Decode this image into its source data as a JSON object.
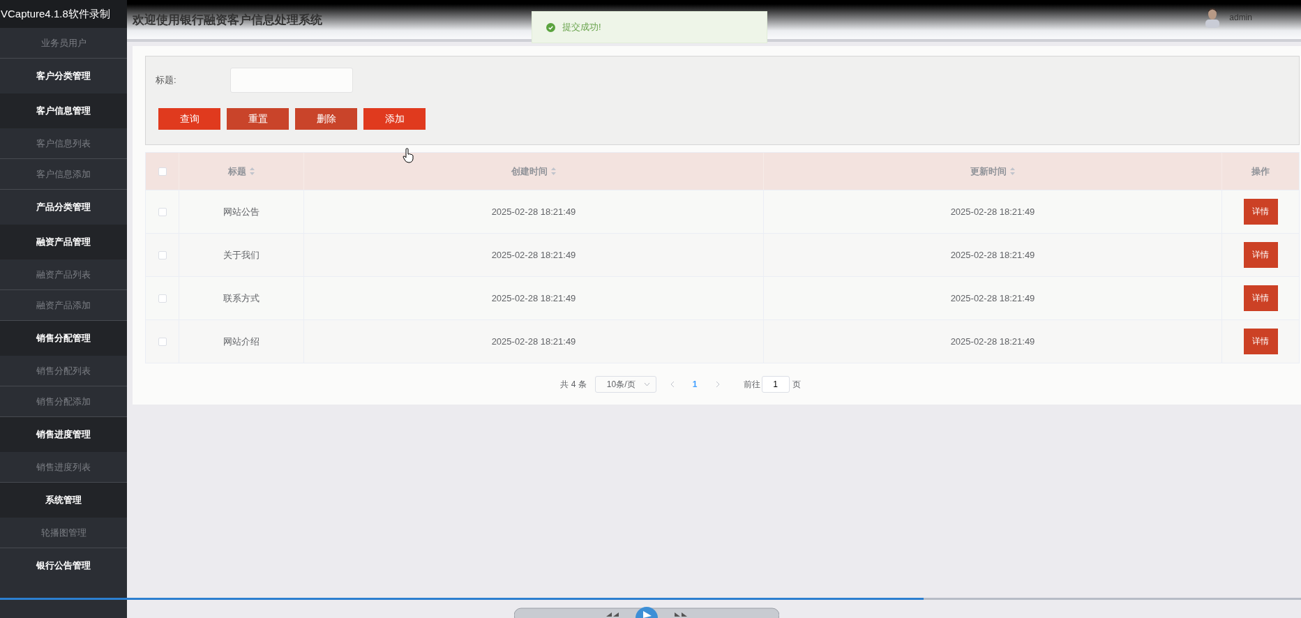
{
  "recorder_overlay": {
    "title": "VCapture4.1.8软件录制"
  },
  "sidebar": {
    "items": [
      {
        "label": "业务员用户",
        "kind": "link"
      },
      {
        "label": "客户分类管理",
        "kind": "group"
      },
      {
        "label": "客户信息管理",
        "kind": "group",
        "children": [
          {
            "label": "客户信息列表",
            "kind": "link"
          },
          {
            "label": "客户信息添加",
            "kind": "link"
          }
        ]
      },
      {
        "label": "产品分类管理",
        "kind": "group"
      },
      {
        "label": "融资产品管理",
        "kind": "group",
        "children": [
          {
            "label": "融资产品列表",
            "kind": "link"
          },
          {
            "label": "融资产品添加",
            "kind": "link"
          }
        ]
      },
      {
        "label": "销售分配管理",
        "kind": "group",
        "children": [
          {
            "label": "销售分配列表",
            "kind": "link"
          },
          {
            "label": "销售分配添加",
            "kind": "link"
          }
        ]
      },
      {
        "label": "销售进度管理",
        "kind": "group",
        "children": [
          {
            "label": "销售进度列表",
            "kind": "link"
          }
        ]
      },
      {
        "label": "系统管理",
        "kind": "group",
        "children": [
          {
            "label": "轮播图管理",
            "kind": "link"
          }
        ]
      },
      {
        "label": "银行公告管理",
        "kind": "group"
      }
    ]
  },
  "header": {
    "title": "欢迎使用银行融资客户信息处理系统",
    "user": "admin"
  },
  "toast": {
    "message": "提交成功!"
  },
  "search": {
    "label": "标题:"
  },
  "buttons": [
    {
      "label": "查询",
      "color": "#e03a1e"
    },
    {
      "label": "重置",
      "color": "#c9442a"
    },
    {
      "label": "删除",
      "color": "#c9442a"
    },
    {
      "label": "添加",
      "color": "#e03a1e"
    }
  ],
  "table": {
    "columns": [
      {
        "label": "标题",
        "sortable": true
      },
      {
        "label": "创建时间",
        "sortable": true
      },
      {
        "label": "更新时间",
        "sortable": true
      },
      {
        "label": "操作",
        "sortable": false
      }
    ],
    "rows": [
      {
        "checked": false,
        "title": "网站公告",
        "created": "2025-02-28 18:21:49",
        "updated": "2025-02-28 18:21:49",
        "action": "详情"
      },
      {
        "checked": false,
        "title": "关于我们",
        "created": "2025-02-28 18:21:49",
        "updated": "2025-02-28 18:21:49",
        "action": "详情"
      },
      {
        "checked": false,
        "title": "联系方式",
        "created": "2025-02-28 18:21:49",
        "updated": "2025-02-28 18:21:49",
        "action": "详情"
      },
      {
        "checked": false,
        "title": "网站介绍",
        "created": "2025-02-28 18:21:49",
        "updated": "2025-02-28 18:21:49",
        "action": "详情"
      }
    ],
    "all_checked": false
  },
  "pagination": {
    "total": "共 4 条",
    "page_size": "10条/页",
    "pages": [
      {
        "label": "1",
        "selected": true
      }
    ],
    "goto_label": "前往",
    "goto_value": "1",
    "goto_suffix": "页"
  },
  "player": {
    "level": 0.71
  }
}
